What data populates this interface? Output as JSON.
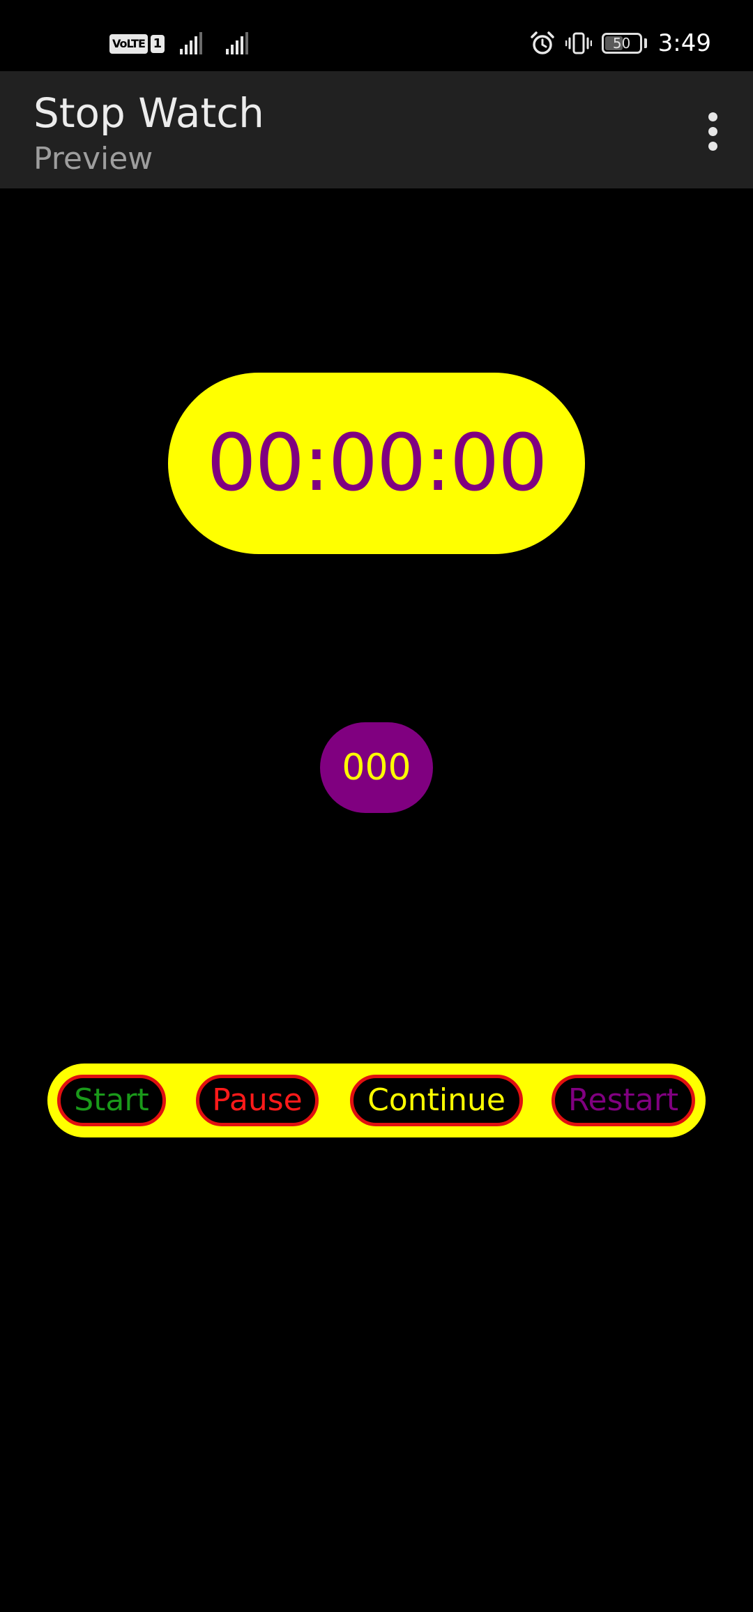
{
  "status_bar": {
    "volte_label": "VoLTE",
    "sim_label": "1",
    "battery_level": "50",
    "time": "3:49",
    "icons": [
      "signal-icon",
      "signal-icon",
      "alarm-icon",
      "vibrate-icon",
      "battery-icon"
    ]
  },
  "app_bar": {
    "title": "Stop Watch",
    "subtitle": "Preview",
    "menu_icon": "more-vert-icon"
  },
  "timer": {
    "display": "00:00:00",
    "milliseconds": "000"
  },
  "controls": {
    "start_label": "Start",
    "pause_label": "Pause",
    "continue_label": "Continue",
    "restart_label": "Restart"
  },
  "colors": {
    "background": "#000000",
    "app_bar": "#212121",
    "timer_bg": "#ffff00",
    "timer_text": "#800080",
    "ms_bg": "#800080",
    "ms_text": "#ffff00",
    "button_border": "#e01010",
    "start_text": "#1a9a1a",
    "pause_text": "#ff1a1a",
    "continue_text": "#ffff00",
    "restart_text": "#800080"
  }
}
